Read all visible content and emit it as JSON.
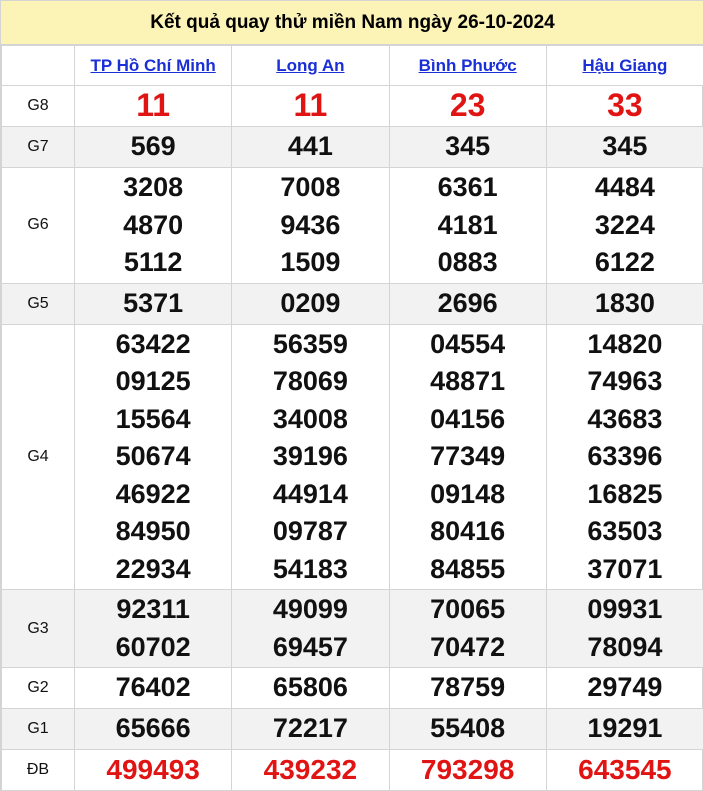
{
  "title": "Kết quả quay thử miền Nam ngày 26-10-2024",
  "provinces": [
    "TP Hồ Chí Minh",
    "Long An",
    "Bình Phước",
    "Hậu Giang"
  ],
  "colors": {
    "title_bg": "#fcf3b6",
    "link": "#1a2fd6",
    "highlight": "#e11414",
    "alt_row": "#f2f2f2"
  },
  "rows": [
    {
      "label": "G8",
      "cells": [
        [
          "11"
        ],
        [
          "11"
        ],
        [
          "23"
        ],
        [
          "33"
        ]
      ]
    },
    {
      "label": "G7",
      "cells": [
        [
          "569"
        ],
        [
          "441"
        ],
        [
          "345"
        ],
        [
          "345"
        ]
      ]
    },
    {
      "label": "G6",
      "cells": [
        [
          "3208",
          "4870",
          "5112"
        ],
        [
          "7008",
          "9436",
          "1509"
        ],
        [
          "6361",
          "4181",
          "0883"
        ],
        [
          "4484",
          "3224",
          "6122"
        ]
      ]
    },
    {
      "label": "G5",
      "cells": [
        [
          "5371"
        ],
        [
          "0209"
        ],
        [
          "2696"
        ],
        [
          "1830"
        ]
      ]
    },
    {
      "label": "G4",
      "cells": [
        [
          "63422",
          "09125",
          "15564",
          "50674",
          "46922",
          "84950",
          "22934"
        ],
        [
          "56359",
          "78069",
          "34008",
          "39196",
          "44914",
          "09787",
          "54183"
        ],
        [
          "04554",
          "48871",
          "04156",
          "77349",
          "09148",
          "80416",
          "84855"
        ],
        [
          "14820",
          "74963",
          "43683",
          "63396",
          "16825",
          "63503",
          "37071"
        ]
      ]
    },
    {
      "label": "G3",
      "cells": [
        [
          "92311",
          "60702"
        ],
        [
          "49099",
          "69457"
        ],
        [
          "70065",
          "70472"
        ],
        [
          "09931",
          "78094"
        ]
      ]
    },
    {
      "label": "G2",
      "cells": [
        [
          "76402"
        ],
        [
          "65806"
        ],
        [
          "78759"
        ],
        [
          "29749"
        ]
      ]
    },
    {
      "label": "G1",
      "cells": [
        [
          "65666"
        ],
        [
          "72217"
        ],
        [
          "55408"
        ],
        [
          "19291"
        ]
      ]
    },
    {
      "label": "ĐB",
      "cells": [
        [
          "499493"
        ],
        [
          "439232"
        ],
        [
          "793298"
        ],
        [
          "643545"
        ]
      ]
    }
  ]
}
